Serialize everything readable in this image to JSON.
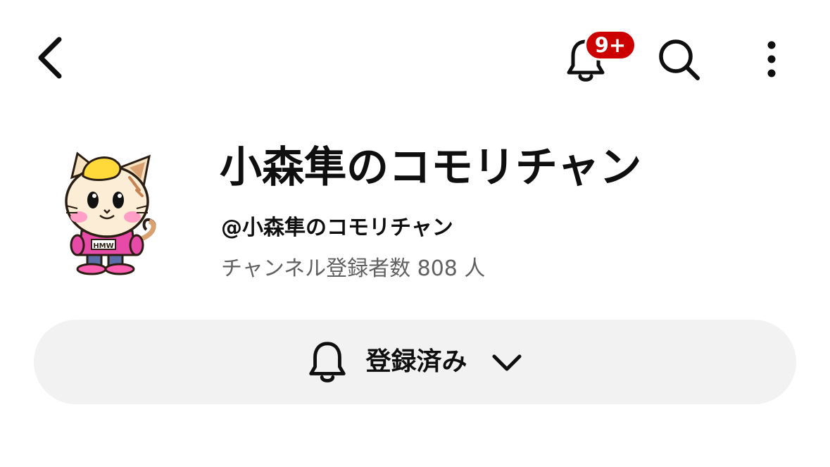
{
  "topbar": {
    "back_icon": "chevron-left-icon",
    "notifications_icon": "bell-icon",
    "notifications_badge": "9+",
    "search_icon": "search-icon",
    "more_icon": "more-vertical-icon",
    "badge_color": "#cc0000"
  },
  "channel": {
    "name": "小森隼のコモリチャン",
    "handle": "@小森隼のコモリチャン",
    "subscribers": "チャンネル登録者数 808 人",
    "avatar": "cat-mascot-avatar"
  },
  "subscribe": {
    "label": "登録済み",
    "bell_icon": "bell-icon",
    "chevron_icon": "chevron-down-icon",
    "background": "#f2f2f2"
  }
}
